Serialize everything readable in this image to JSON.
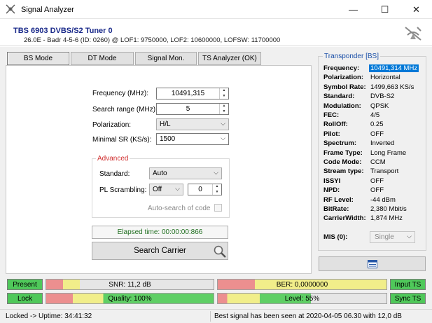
{
  "window": {
    "title": "Signal Analyzer",
    "minimize": "—",
    "maximize": "☐",
    "close": "✕"
  },
  "header": {
    "tuner_name": "TBS 6903 DVBS/S2 Tuner 0",
    "tuner_info": "26.0E - Badr 4-5-6 (ID: 0260) @ LOF1: 9750000, LOF2: 10600000, LOFSW: 11700000"
  },
  "tabs": [
    {
      "label": "BS Mode",
      "active": true
    },
    {
      "label": "DT Mode",
      "active": false
    },
    {
      "label": "Signal Mon.",
      "active": false
    },
    {
      "label": "TS Analyzer (OK)",
      "active": false
    }
  ],
  "form": {
    "frequency_label": "Frequency (MHz):",
    "frequency_value": "10491,315",
    "search_range_label": "Search range (MHz):",
    "search_range_value": "5",
    "polarization_label": "Polarization:",
    "polarization_value": "H/L",
    "min_sr_label": "Minimal SR (KS/s):",
    "min_sr_value": "1500"
  },
  "advanced": {
    "legend": "Advanced",
    "standard_label": "Standard:",
    "standard_value": "Auto",
    "pl_label": "PL Scrambling:",
    "pl_value": "Off",
    "pl_number": "0",
    "auto_search_label": "Auto-search of code",
    "auto_search_checked": false
  },
  "elapsed": "Elapsed time: 00:00:00:866",
  "search_button": "Search Carrier",
  "transponder": {
    "title": "Transponder [BS]",
    "rows": [
      {
        "k": "Frequency:",
        "v": "10491,314 MHz"
      },
      {
        "k": "Polarization:",
        "v": "Horizontal"
      },
      {
        "k": "Symbol Rate:",
        "v": "1499,663 KS/s"
      },
      {
        "k": "Standard:",
        "v": "DVB-S2"
      },
      {
        "k": "Modulation:",
        "v": "QPSK"
      },
      {
        "k": "FEC:",
        "v": "4/5"
      },
      {
        "k": "RollOff:",
        "v": "0.25"
      },
      {
        "k": "Pilot:",
        "v": "OFF"
      },
      {
        "k": "Spectrum:",
        "v": "Inverted"
      },
      {
        "k": "Frame Type:",
        "v": "Long Frame"
      },
      {
        "k": "Code Mode:",
        "v": "CCM"
      },
      {
        "k": "Stream type:",
        "v": "Transport"
      },
      {
        "k": "ISSYI",
        "v": "OFF"
      },
      {
        "k": "NPD:",
        "v": "OFF"
      },
      {
        "k": "RF Level:",
        "v": "-44 dBm"
      },
      {
        "k": "BitRate:",
        "v": "2,380 Mbit/s"
      },
      {
        "k": "CarrierWidth:",
        "v": "1,874 MHz"
      }
    ],
    "mis_label": "MIS (0):",
    "mis_value": "Single"
  },
  "meters": {
    "present": "Present",
    "lock": "Lock",
    "input_ts": "Input TS",
    "sync_ts": "Sync TS",
    "snr": {
      "label": "SNR: 11,2 dB",
      "level": 0.2
    },
    "ber": {
      "label": "BER: 0,0000000",
      "level": 1.0
    },
    "quality": {
      "label": "Quality: 100%",
      "level": 1.0
    },
    "level": {
      "label": "Level: 55%",
      "level": 0.55
    }
  },
  "status": {
    "left": "Locked -> Uptime: 34:41:32",
    "right": "Best signal has been seen at 2020-04-05 06.30 with 12,0 dB"
  },
  "colors": {
    "accent": "#0078d7",
    "ok_green": "#4fc85a",
    "legend_red": "#d03030",
    "title_blue": "#1a2a8a"
  }
}
